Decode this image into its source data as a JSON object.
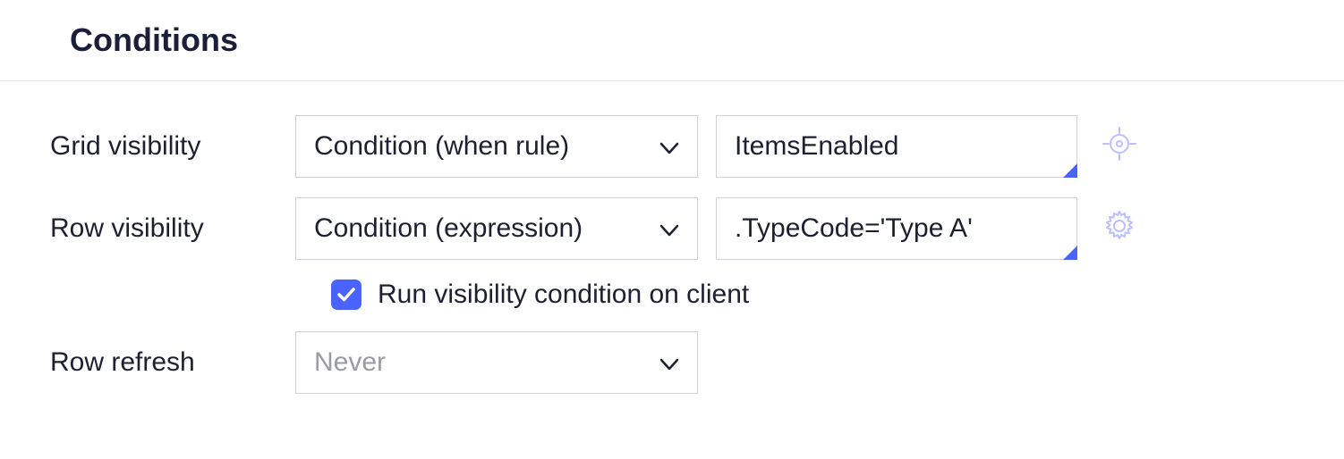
{
  "section": {
    "title": "Conditions"
  },
  "grid_visibility": {
    "label": "Grid visibility",
    "select_value": "Condition (when rule)",
    "value": "ItemsEnabled"
  },
  "row_visibility": {
    "label": "Row visibility",
    "select_value": "Condition (expression)",
    "value": ".TypeCode='Type A'"
  },
  "run_on_client": {
    "label": "Run visibility condition on client",
    "checked": true
  },
  "row_refresh": {
    "label": "Row refresh",
    "select_value": "Never"
  }
}
